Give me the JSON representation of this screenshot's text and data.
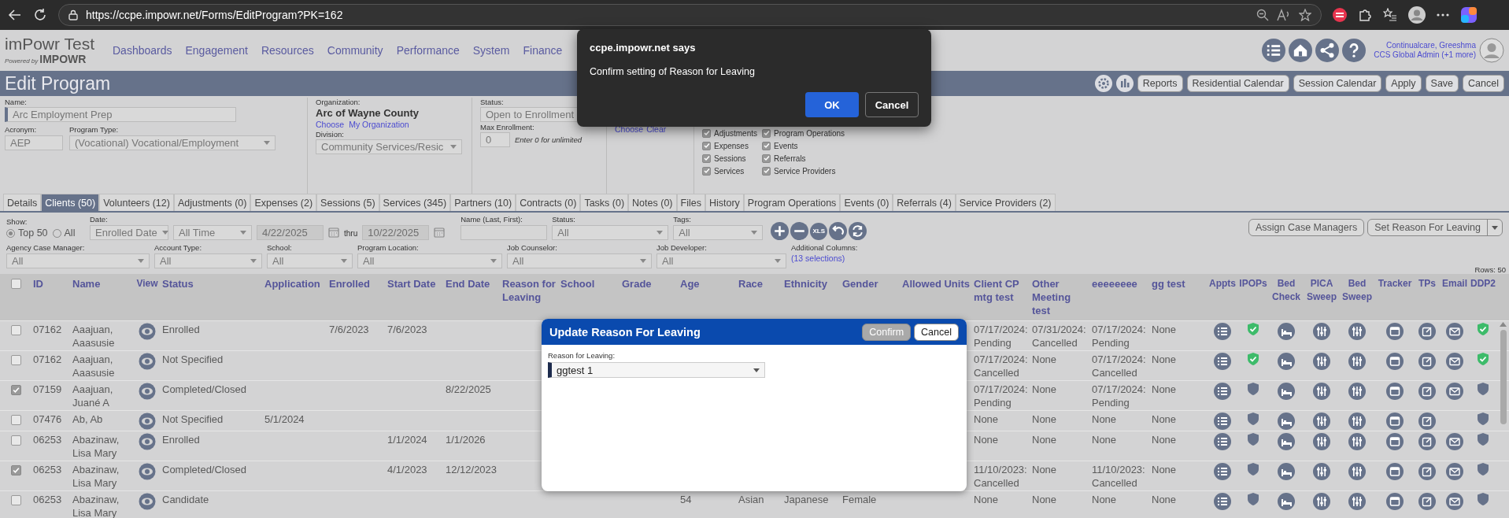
{
  "browser": {
    "url": "https://ccpe.impowr.net/Forms/EditProgram?PK=162"
  },
  "app": {
    "title": "imPowr Test",
    "powered_by": "Powered by",
    "brand": "IMPOWR"
  },
  "nav": [
    "Dashboards",
    "Engagement",
    "Resources",
    "Community",
    "Performance",
    "System",
    "Finance"
  ],
  "user": {
    "name": "Continualcare, Greeshma",
    "role": "CCS Global Admin (+1 more)"
  },
  "page_title": "Edit Program",
  "toolbar_buttons": [
    "Reports",
    "Residential Calendar",
    "Session Calendar",
    "Apply",
    "Save",
    "Cancel"
  ],
  "form": {
    "name_label": "Name:",
    "name": "Arc Employment Prep",
    "acronym_label": "Acronym:",
    "acronym": "AEP",
    "program_type_label": "Program Type:",
    "program_type": "(Vocational) Vocational/Employment",
    "organization_label": "Organization:",
    "organization": "Arc of Wayne County",
    "org_links": [
      "Choose",
      "My Organization"
    ],
    "division_label": "Division:",
    "division": "Community Services/Resic",
    "status_label": "Status:",
    "status": "Open to Enrollment",
    "max_enrollment_label": "Max Enrollment:",
    "max_enrollment": "0",
    "max_enrollment_hint": "Enter 0 for unlimited",
    "links": [
      "Choose",
      "Clear"
    ],
    "sections": [
      {
        "label": "Adjustments",
        "checked": true
      },
      {
        "label": "Expenses",
        "checked": true
      },
      {
        "label": "Sessions",
        "checked": true
      },
      {
        "label": "Services",
        "checked": true
      },
      {
        "label": "Program Operations",
        "checked": true
      },
      {
        "label": "Events",
        "checked": true
      },
      {
        "label": "Referrals",
        "checked": true
      },
      {
        "label": "Service Providers",
        "checked": true
      }
    ]
  },
  "tabs": [
    {
      "label": "Details",
      "selected": false
    },
    {
      "label": "Clients (50)",
      "selected": true
    },
    {
      "label": "Volunteers (12)",
      "selected": false
    },
    {
      "label": "Adjustments (0)",
      "selected": false
    },
    {
      "label": "Expenses (2)",
      "selected": false
    },
    {
      "label": "Sessions (5)",
      "selected": false
    },
    {
      "label": "Services (345)",
      "selected": false
    },
    {
      "label": "Partners (10)",
      "selected": false
    },
    {
      "label": "Contracts (0)",
      "selected": false
    },
    {
      "label": "Tasks (0)",
      "selected": false
    },
    {
      "label": "Notes (0)",
      "selected": false
    },
    {
      "label": "Files",
      "selected": false
    },
    {
      "label": "History",
      "selected": false
    },
    {
      "label": "Program Operations",
      "selected": false
    },
    {
      "label": "Events (0)",
      "selected": false
    },
    {
      "label": "Referrals (4)",
      "selected": false
    },
    {
      "label": "Service Providers (2)",
      "selected": false
    }
  ],
  "filters": {
    "show_label": "Show:",
    "show_options": [
      {
        "label": "Top 50",
        "selected": true
      },
      {
        "label": "All",
        "selected": false
      }
    ],
    "date_label": "Date:",
    "date_field": "Enrolled Date",
    "date_range": "All Time",
    "date_from": "4/22/2025",
    "thru": "thru",
    "date_to": "10/22/2025",
    "dates_disabled": true,
    "name_label": "Name (Last, First):",
    "status_label": "Status:",
    "status": "All",
    "tags_label": "Tags:",
    "tags": "All",
    "xls": "XLS",
    "assign_button": "Assign Case Managers",
    "reason_button": "Set Reason For Leaving",
    "row2": [
      {
        "label": "Agency Case Manager:",
        "value": "All"
      },
      {
        "label": "Account Type:",
        "value": "All"
      },
      {
        "label": "School:",
        "value": "All"
      },
      {
        "label": "Program Location:",
        "value": "All"
      },
      {
        "label": "Job Counselor:",
        "value": "All"
      },
      {
        "label": "Job Developer:",
        "value": "All"
      }
    ],
    "additional_label": "Additional Columns:",
    "additional_link": "(13 selections)",
    "rows_count": "Rows: 50"
  },
  "table": {
    "select_all": {
      "checked": false
    },
    "columns": [
      {
        "label": "ID",
        "kind": "text"
      },
      {
        "label": "Name",
        "kind": "text"
      },
      {
        "label": "View",
        "kind": "view"
      },
      {
        "label": "Status",
        "kind": "text"
      },
      {
        "label": "Application",
        "kind": "text"
      },
      {
        "label": "Enrolled",
        "kind": "text"
      },
      {
        "label": "Start Date",
        "kind": "text"
      },
      {
        "label": "End Date",
        "kind": "text"
      },
      {
        "label": "Reason for Leaving",
        "kind": "text"
      },
      {
        "label": "School",
        "kind": "text"
      },
      {
        "label": "Grade",
        "kind": "text"
      },
      {
        "label": "Age",
        "kind": "text"
      },
      {
        "label": "Race",
        "kind": "text"
      },
      {
        "label": "Ethnicity",
        "kind": "text"
      },
      {
        "label": "Gender",
        "kind": "text"
      },
      {
        "label": "Allowed Units",
        "kind": "text"
      },
      {
        "label": "Client CP mtg test",
        "kind": "text"
      },
      {
        "label": "Other Meeting test",
        "kind": "text"
      },
      {
        "label": "eeeeeeee",
        "kind": "text"
      },
      {
        "label": "gg test",
        "kind": "text"
      },
      {
        "label": "Appts",
        "kind": "icon"
      },
      {
        "label": "IPOPs",
        "kind": "icon"
      },
      {
        "label": "Bed Check",
        "kind": "icon"
      },
      {
        "label": "PICA Sweep",
        "kind": "icon"
      },
      {
        "label": "Bed Sweep",
        "kind": "icon"
      },
      {
        "label": "Tracker",
        "kind": "icon"
      },
      {
        "label": "TPs",
        "kind": "icon"
      },
      {
        "label": "Email",
        "kind": "icon"
      },
      {
        "label": "DDP2",
        "kind": "icon"
      }
    ],
    "rows": [
      {
        "checked": false,
        "id": "07162",
        "name": "Aaajuan, Aaasusie",
        "status": "Enrolled",
        "enrolled": "7/6/2023",
        "start_date": "7/6/2023",
        "client_cp": "07/17/2024: Pending",
        "other_meeting": "07/31/2024: Cancelled",
        "eeeeeeee": "07/17/2024: Pending",
        "gg_test": "None",
        "ipops_ok": true,
        "email": true,
        "ddp2_ok": true
      },
      {
        "checked": false,
        "id": "07162",
        "name": "Aaajuan, Aaasusie",
        "status": "Not Specified",
        "client_cp": "07/17/2024: Cancelled",
        "other_meeting": "None",
        "eeeeeeee": "07/17/2024: Cancelled",
        "gg_test": "None",
        "ipops_ok": true,
        "email": true,
        "ddp2_ok": true
      },
      {
        "checked": true,
        "id": "07159",
        "name": "Aaajuan, Juané A",
        "status": "Completed/Closed",
        "end_date": "8/22/2025",
        "client_cp": "07/17/2024: Pending",
        "other_meeting": "None",
        "eeeeeeee": "07/17/2024: Pending",
        "gg_test": "None",
        "ipops_ok": false,
        "email": true,
        "ddp2_ok": false
      },
      {
        "checked": false,
        "id": "07476",
        "name": "Ab, Ab",
        "status": "Not Specified",
        "application": "5/1/2024",
        "client_cp": "None",
        "other_meeting": "None",
        "eeeeeeee": "None",
        "gg_test": "None",
        "ipops_ok": false,
        "email": false,
        "ddp2_ok": false
      },
      {
        "checked": false,
        "id": "06253",
        "name": "Abazinaw, Lisa Mary",
        "status": "Enrolled",
        "start_date": "1/1/2024",
        "end_date": "1/1/2026",
        "client_cp": "None",
        "other_meeting": "None",
        "eeeeeeee": "None",
        "gg_test": "None",
        "ipops_ok": false,
        "email": true,
        "ddp2_ok": false
      },
      {
        "checked": true,
        "id": "06253",
        "name": "Abazinaw, Lisa Mary",
        "status": "Completed/Closed",
        "start_date": "4/1/2023",
        "end_date": "12/12/2023",
        "client_cp": "11/10/2023: Cancelled",
        "other_meeting": "None",
        "eeeeeeee": "11/10/2023: Cancelled",
        "gg_test": "None",
        "ipops_ok": false,
        "email": true,
        "ddp2_ok": false
      },
      {
        "checked": false,
        "id": "06253",
        "name": "Abazinaw, Lisa Mary",
        "status": "Candidate",
        "age": "54",
        "race": "Asian",
        "ethnicity": "Japanese",
        "gender": "Female",
        "client_cp": "None",
        "other_meeting": "None",
        "eeeeeeee": "None",
        "gg_test": "None",
        "ipops_ok": false,
        "email": true,
        "ddp2_ok": false
      }
    ]
  },
  "modal": {
    "title": "Update Reason For Leaving",
    "confirm": {
      "label": "Confirm",
      "disabled": true
    },
    "cancel": "Cancel",
    "field_label": "Reason for Leaving:",
    "field_value": "ggtest 1"
  },
  "browser_dialog": {
    "title": "ccpe.impowr.net says",
    "message": "Confirm setting of Reason for Leaving",
    "ok": "OK",
    "cancel": "Cancel"
  }
}
